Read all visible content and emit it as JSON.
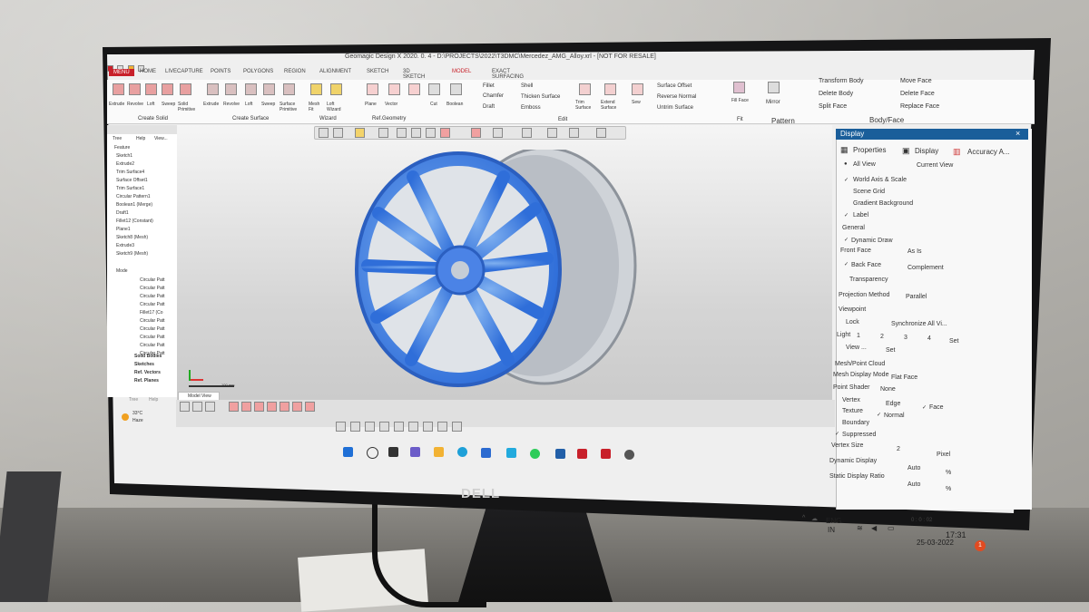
{
  "window": {
    "title": "Geomagic Design X 2020. 0. 4 - D:\\PROJECTS\\2022\\T3DMC\\Mercedez_AMG_Alloy.xrl - [NOT FOR RESALE]"
  },
  "ribbon_tabs": [
    "MENU",
    "HOME",
    "LIVECAPTURE",
    "POINTS",
    "POLYGONS",
    "REGION",
    "ALIGNMENT",
    "SKETCH",
    "3D SKETCH",
    "MODEL",
    "EXACT SURFACING"
  ],
  "active_tab": "MODEL",
  "ribbon": {
    "create_solid": [
      "Extrude",
      "Revolve",
      "Loft",
      "Sweep",
      "Solid Primitive"
    ],
    "create_surface": [
      "Extrude",
      "Revolve",
      "Loft",
      "Sweep",
      "Surface Primitive"
    ],
    "wizard": [
      "Mesh Fit",
      "Loft Wizard"
    ],
    "ref_geometry": [
      "Plane",
      "Vector",
      "Point"
    ],
    "edit": [
      "Cut",
      "Boolean",
      "Fillet",
      "Chamfer",
      "Draft",
      "Shell",
      "Thicken Surface",
      "Emboss",
      "Trim Surface",
      "Extend Surface",
      "Sew",
      "Surface Offset",
      "Reverse Normal",
      "Untrim Surface"
    ],
    "fit": [
      "Fill Face"
    ],
    "pattern": [
      "Mirror"
    ],
    "body_face": [
      "Transform Body",
      "Delete Body",
      "Split Face",
      "Move Face",
      "Delete Face",
      "Replace Face"
    ],
    "group_labels": [
      "Create Solid",
      "Create Surface",
      "Wizard",
      "Ref.Geometry",
      "Edit",
      "Fit",
      "Pattern",
      "Body/Face"
    ]
  },
  "feature_tree": {
    "tabs": [
      "Tree",
      "Help",
      "View..."
    ],
    "heading": "Feature",
    "items": [
      "Sketch1",
      "Extrude2",
      "Trim Surface4",
      "Surface Offset1",
      "Trim Surface1",
      "Circular Pattern1",
      "Boolean1 (Merge)",
      "Draft1",
      "Fillet12 (Constant)",
      "Plane1",
      "Sketch8 (Mesh)",
      "Extrude3",
      "Sketch9 (Mesh)"
    ],
    "model_heading": "Mode",
    "model_items": [
      "Circular Patt",
      "Circular Patt",
      "Circular Patt",
      "Circular Patt",
      "Fillet17 (Co",
      "Circular Patt",
      "Circular Patt",
      "Circular Patt",
      "Circular Patt",
      "Circular Patt"
    ],
    "groups": [
      "Solid Bodies",
      "Sketches",
      "Ref. Vectors",
      "Ref. Planes"
    ],
    "bottom_tabs": [
      "Tree",
      "Help"
    ]
  },
  "viewport": {
    "tab_label": "Model View",
    "scale_label": "100 mm"
  },
  "display_panel": {
    "header": "Display",
    "tabs": [
      "Properties",
      "Display",
      "Accuracy A..."
    ],
    "view_options": [
      "All View",
      "Current View"
    ],
    "checks": [
      "World Axis & Scale",
      "Scene Grid",
      "Gradient Background",
      "Label"
    ],
    "general_label": "General",
    "dynamic_draw": "Dynamic Draw",
    "front_face_label": "Front Face",
    "front_face_value": "As Is",
    "back_face_label": "Back Face",
    "back_face_value": "Complement",
    "transparency_label": "Transparency",
    "projection_label": "Projection Method",
    "projection_value": "Parallel",
    "viewpoint_label": "Viewpoint",
    "lock_label": "Lock",
    "sync_label": "Synchronize All Vi...",
    "light_label": "Light",
    "light_values": [
      "1",
      "2",
      "3",
      "4"
    ],
    "light_set": "Set",
    "view_label": "View ...",
    "view_set": "Set",
    "mesh_label": "Mesh/Point Cloud",
    "mesh_display_label": "Mesh Display Mode",
    "mesh_display_value": "Flat Face",
    "point_shader_label": "Point Shader",
    "point_shader_value": "None",
    "vertex": "Vertex",
    "edge": "Edge",
    "face": "Face",
    "texture": "Texture",
    "normal": "Normal",
    "boundary": "Boundary",
    "suppressed": "Suppressed",
    "vertex_size_label": "Vertex Size",
    "vertex_size_value": "2",
    "vertex_size_unit": "Pixel",
    "dynamic_display_label": "Dynamic Display",
    "dynamic_display_value": "Auto",
    "static_ratio_label": "Static Display Ratio",
    "static_ratio_value": "Auto",
    "percent": "%"
  },
  "status": {
    "time_code": "0 : 0 : 02"
  },
  "weather": {
    "temp": "33°C",
    "condition": "Haze"
  },
  "taskbar": {
    "lang": "ENG",
    "region": "IN",
    "time": "17:31",
    "date": "25-03-2022",
    "notification_count": "1"
  },
  "monitor_brand": "DELL"
}
